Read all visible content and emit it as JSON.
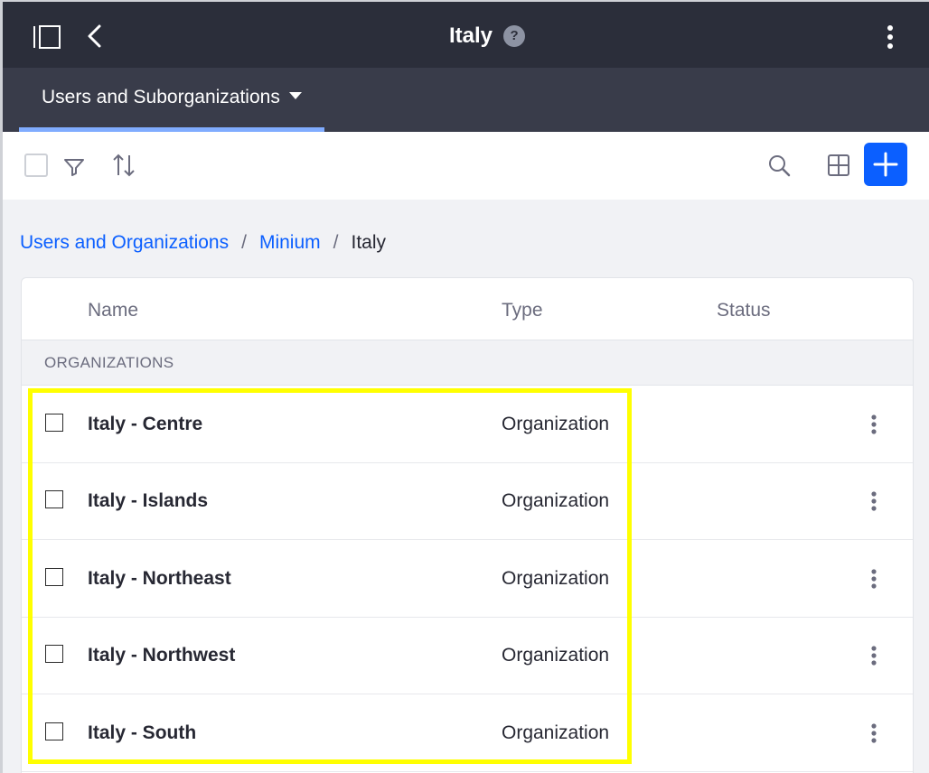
{
  "header": {
    "title": "Italy",
    "help_icon": "?",
    "icons": [
      "sidebar-toggle-icon",
      "back-arrow-icon",
      "help-icon",
      "kebab-icon"
    ]
  },
  "nav": {
    "active_tab": "Users and Suborganizations"
  },
  "toolbar": {
    "icons": [
      "select-all-checkbox",
      "filter-icon",
      "sort-icon",
      "search-icon",
      "grid-view-icon",
      "plus-icon"
    ],
    "add_color": "#0b5fff"
  },
  "breadcrumb": {
    "items": [
      "Users and Organizations",
      "Minium",
      "Italy"
    ],
    "separator": "/"
  },
  "table": {
    "columns": [
      "Name",
      "Type",
      "Status"
    ],
    "group_label": "ORGANIZATIONS",
    "rows": [
      {
        "name": "Italy - Centre",
        "type": "Organization"
      },
      {
        "name": "Italy - Islands",
        "type": "Organization"
      },
      {
        "name": "Italy - Northeast",
        "type": "Organization"
      },
      {
        "name": "Italy - Northwest",
        "type": "Organization"
      },
      {
        "name": "Italy - South",
        "type": "Organization"
      }
    ]
  },
  "colors": {
    "header_bg": "#2b2e3a",
    "nav_bg": "#393c4a",
    "tab_underline": "#80acff",
    "link": "#0b5fff",
    "highlight": "#ffff00"
  }
}
